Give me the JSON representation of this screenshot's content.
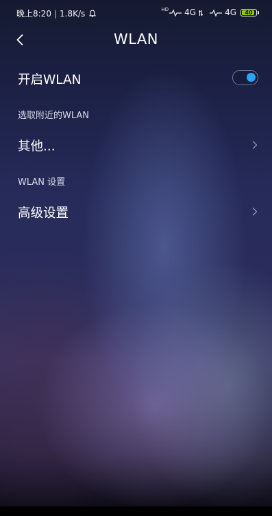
{
  "status_bar": {
    "time": "晚上8:20",
    "separator": "|",
    "speed": "1.8K/s",
    "hd_label": "HD",
    "network_1": "4G",
    "network_2": "4G",
    "battery": "40"
  },
  "header": {
    "title": "WLAN"
  },
  "wlan_toggle": {
    "label": "开启WLAN",
    "enabled": true
  },
  "nearby_section": {
    "title": "选取附近的WLAN"
  },
  "other_item": {
    "label": "其他..."
  },
  "settings_section": {
    "title": "WLAN 设置"
  },
  "advanced_item": {
    "label": "高级设置"
  },
  "colors": {
    "accent": "#2aa5f3",
    "battery": "#8bd000"
  }
}
